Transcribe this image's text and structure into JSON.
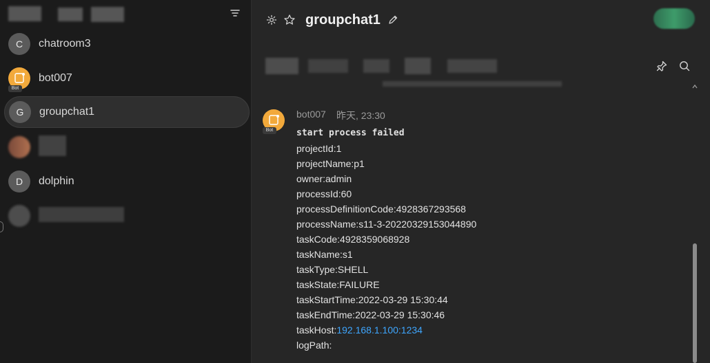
{
  "sidebar": {
    "chats": [
      {
        "initial": "C",
        "name": "chatroom3",
        "bot": false,
        "active": false
      },
      {
        "initial": "",
        "name": "bot007",
        "bot": true,
        "active": false
      },
      {
        "initial": "G",
        "name": "groupchat1",
        "bot": false,
        "active": true
      },
      {
        "initial": "D",
        "name": "dolphin",
        "bot": false,
        "active": false
      }
    ],
    "bot_badge": "Bot"
  },
  "header": {
    "title": "groupchat1"
  },
  "message": {
    "sender": "bot007",
    "time": "昨天, 23:30",
    "lines": [
      "start process failed",
      "projectId:1",
      "projectName:p1",
      "owner:admin",
      "processId:60",
      "processDefinitionCode:4928367293568",
      "processName:s11-3-20220329153044890",
      "taskCode:4928359068928",
      "taskName:s1",
      "taskType:SHELL",
      "taskState:FAILURE",
      "taskStartTime:2022-03-29 15:30:44",
      "taskEndTime:2022-03-29 15:30:46"
    ],
    "task_host_label": "taskHost:",
    "task_host_value": "192.168.1.100:1234",
    "log_path": "logPath:"
  },
  "colors": {
    "accent_link": "#3ea6ff",
    "bot_avatar": "#f2a93b",
    "presence": "#3e9b6a"
  },
  "icons": [
    "filter-icon",
    "gear-icon",
    "star-icon",
    "edit-icon",
    "pin-icon",
    "search-icon"
  ]
}
